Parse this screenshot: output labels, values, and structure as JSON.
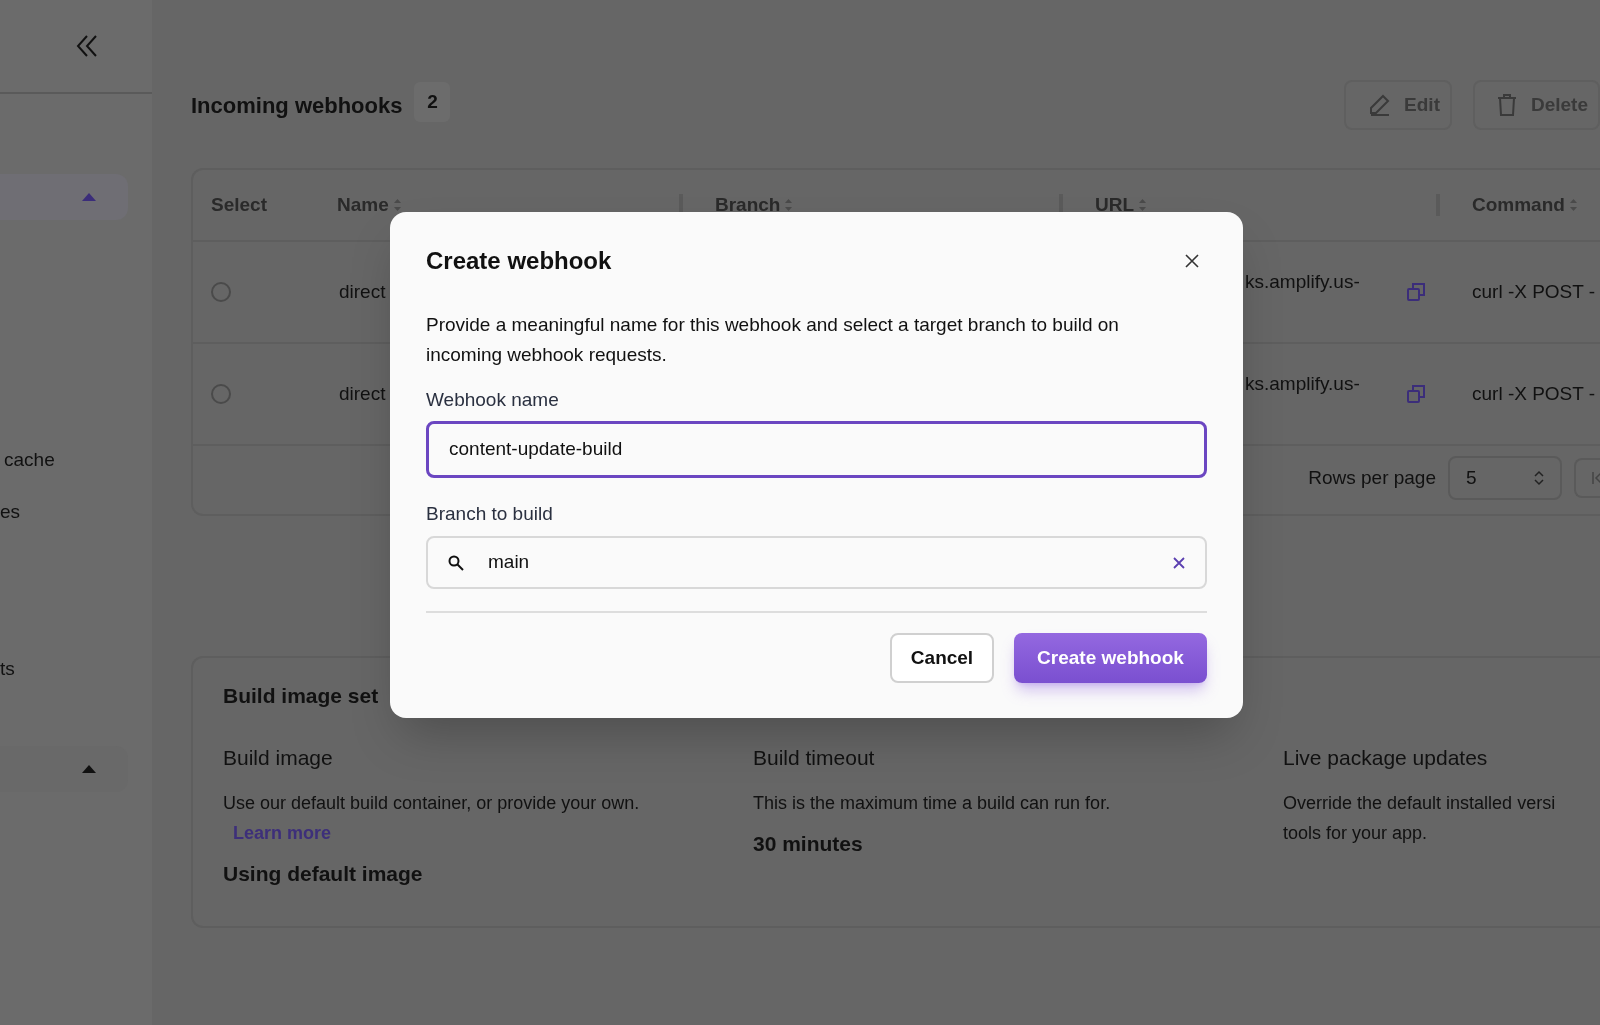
{
  "sidebar": {
    "groups": [
      {
        "selected": true,
        "expanded": true
      },
      {
        "selected": false,
        "expanded": true
      }
    ],
    "items": [
      "cache",
      "es",
      "ts"
    ]
  },
  "webhooks": {
    "title": "Incoming webhooks",
    "count": "2",
    "actions": [
      {
        "kind": "edit",
        "label": "Edit"
      },
      {
        "kind": "delete",
        "label": "Delete"
      }
    ],
    "columns": [
      "Select",
      "Name",
      "Branch",
      "URL",
      "Command"
    ],
    "rows": [
      {
        "selected": false,
        "name": "direct",
        "url": "ks.amplify.us-",
        "command": "curl -X POST -"
      },
      {
        "selected": false,
        "name": "direct",
        "url": "ks.amplify.us-",
        "command": "curl -X POST -"
      }
    ],
    "rows_per_page": {
      "label": "Rows per page",
      "value": "5"
    }
  },
  "build_image_settings": {
    "title": "Build image set",
    "sections": [
      {
        "title": "Build image",
        "text": "Use our default build container, or provide your own.",
        "link": "Learn more",
        "value": "Using default image"
      },
      {
        "title": "Build timeout",
        "text": "This is the maximum time a build can run for.",
        "value": "30 minutes"
      },
      {
        "title": "Live package updates",
        "text": "Override the default installed versi tools for your app."
      }
    ]
  },
  "modal": {
    "title": "Create webhook",
    "description": "Provide a meaningful name for this webhook and select a target branch to build on incoming webhook requests.",
    "name_label": "Webhook name",
    "name_value": "content-update-build",
    "name_focused": true,
    "branch_label": "Branch to build",
    "branch_value": "main",
    "buttons": [
      {
        "kind": "secondary",
        "label": "Cancel"
      },
      {
        "kind": "primary",
        "label": "Create webhook"
      }
    ]
  }
}
